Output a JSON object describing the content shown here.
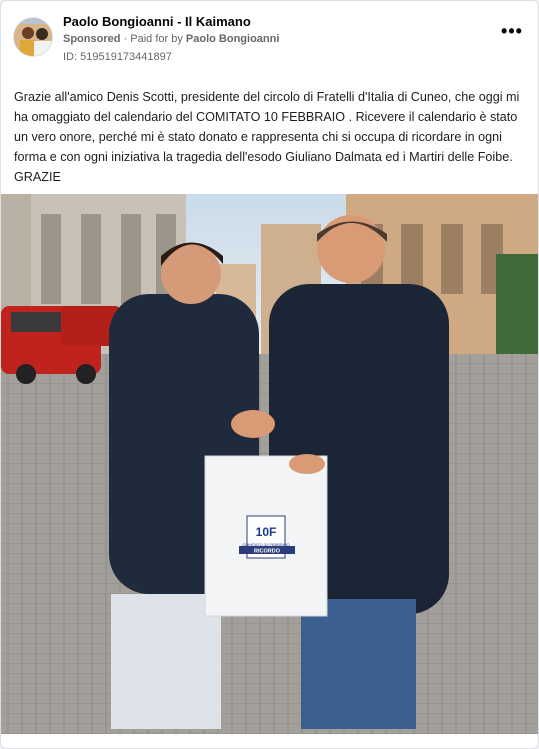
{
  "post": {
    "author": "Paolo Bongioanni - Il Kaimano",
    "sponsored_label": "Sponsored",
    "separator": "·",
    "paid_for_by": "Paid for by",
    "payer": "Paolo Bongioanni",
    "ad_id": "ID: 519519173441897",
    "more_label": "•••",
    "body_text": "Grazie all'amico Denis Scotti, presidente del circolo di Fratelli d'Italia di Cuneo, che oggi mi ha omaggiato del calendario del COMITATO 10 FEBBRAIO . Ricevere il calendario è stato un vero onore, perché mi è stato donato e rappresenta chi si occupa di ricordare in ogni forma e con ogni iniziativa la tragedia dell'esodo Giuliano Dalmata ed i Martiri delle Foibe. GRAZIE"
  },
  "photo": {
    "calendar_logo": "10F",
    "calendar_caption": "COMITATO 10 FEBBRAIO",
    "calendar_banner": "RICORDO"
  },
  "colors": {
    "text_primary": "#050505",
    "text_secondary": "#65676b",
    "card_border": "#dddfe2"
  }
}
